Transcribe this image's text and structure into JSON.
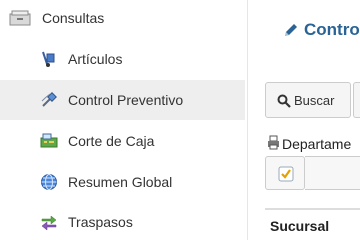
{
  "sidebar": {
    "header": {
      "label": "Consultas"
    },
    "items": [
      {
        "label": "Artículos"
      },
      {
        "label": "Control Preventivo"
      },
      {
        "label": "Corte de Caja"
      },
      {
        "label": "Resumen Global"
      },
      {
        "label": "Traspasos"
      }
    ],
    "active_index": 1
  },
  "main": {
    "title": "Contro",
    "search_button_label": "Buscar",
    "department_label": "Departame",
    "table": {
      "columns": [
        "Sucursal"
      ]
    }
  },
  "colors": {
    "title": "#2a6496",
    "active_item_bg": "#eeeeee",
    "checkbox_check": "#e8a000"
  },
  "icons": {
    "header": "folder-drawer-icon",
    "articulos": "hand-truck-icon",
    "control_preventivo": "satellite-icon",
    "corte_de_caja": "cash-register-icon",
    "resumen_global": "globe-icon",
    "traspasos": "arrows-transfer-icon",
    "title": "pencil-icon",
    "buscar": "search-icon",
    "department": "printer-icon",
    "checkbox": "checkbox-checked-icon"
  }
}
